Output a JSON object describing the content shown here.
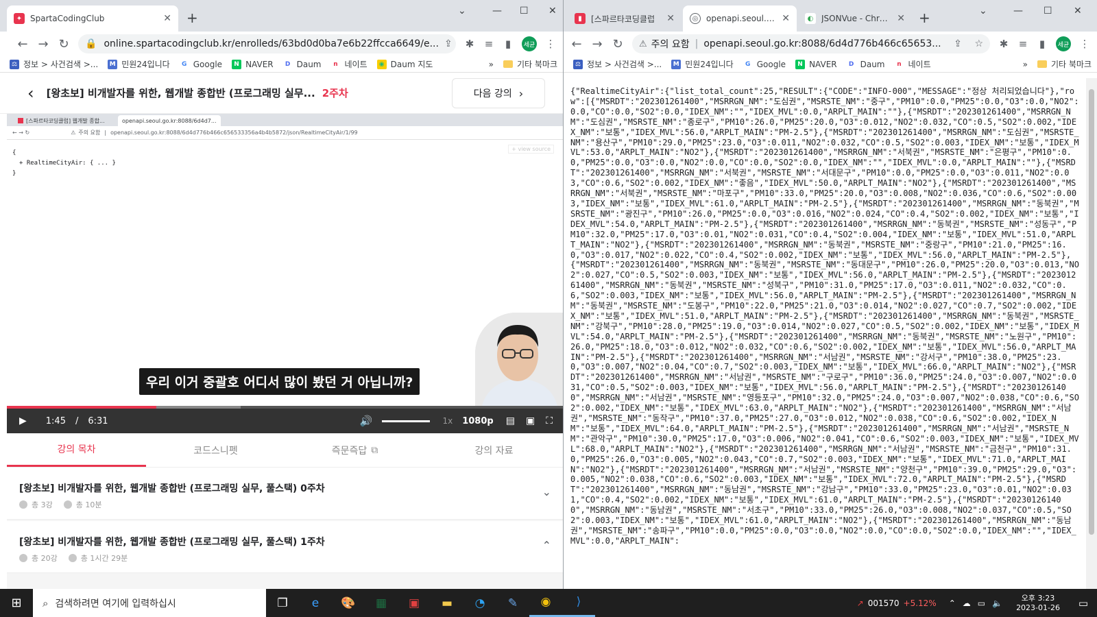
{
  "left": {
    "tabs": [
      {
        "title": "SpartaCodingClub",
        "active": true
      }
    ],
    "url": "online.spartacodingclub.kr/enrolleds/63bd0d0ba7e6b22ffcca6649/e...",
    "avatar": "세균",
    "bookmarks": [
      "정보 > 사건검색 >...",
      "민원24입니다",
      "Google",
      "NAVER",
      "Daum",
      "네이트",
      "Daum 지도"
    ],
    "bookmarks_more": "»",
    "other_bookmarks": "기타 북마크",
    "lecture_title": "[왕초보] 비개발자를 위한, 웹개발 종합반 (프로그래밍 실무...",
    "week": "2주차",
    "next_button": "다음 강의",
    "inner_browser": {
      "tab1": "[스파르타코딩클럽] 웹개발 종합...",
      "tab2": "openapi.seoul.go.kr:8088/6d4d7...",
      "url_warn": "주의 요함",
      "url": "openapi.seoul.go.kr:8088/6d4d776b466c656533356a4b4b5872/json/RealtimeCityAir/1/99",
      "view_source": "view source",
      "json_lines": [
        "{",
        "+ RealtimeCityAir: { ... }",
        "}"
      ]
    },
    "caption": "우리 이거 중괄호 어디서 많이 봤던 거 아닙니까?",
    "player": {
      "current": "1:45",
      "total": "6:31",
      "progress_fraction": 0.268,
      "buffer_fraction": 0.42,
      "speed": "1x",
      "quality": "1080p"
    },
    "lesson_tabs": [
      "강의 목차",
      "코드스니펫",
      "즉문즉답",
      "강의 자료"
    ],
    "curriculum": [
      {
        "title": "[왕초보] 비개발자를 위한, 웹개발 종합반 (프로그래밍 실무, 풀스택) 0주차",
        "lessons": "총 3강",
        "duration": "총 10분",
        "chevron": "⌄"
      },
      {
        "title": "[왕초보] 비개발자를 위한, 웹개발 종합반 (프로그래밍 실무, 풀스택) 1주차",
        "lessons": "총 20강",
        "duration": "총 1시간 29분",
        "chevron": "⌃"
      }
    ]
  },
  "right": {
    "tabs": [
      {
        "title": "[스파르타코딩클럽",
        "active": false
      },
      {
        "title": "openapi.seoul.go.k",
        "active": true
      },
      {
        "title": "JSONVue - Chrom",
        "active": false
      }
    ],
    "url_warn": "주의 요함",
    "url": "openapi.seoul.go.kr:8088/6d4d776b466c65653...",
    "avatar": "세균",
    "bookmarks": [
      "정보 > 사건검색 >...",
      "민원24입니다",
      "Google",
      "NAVER",
      "Daum",
      "네이트"
    ],
    "bookmarks_more": "»",
    "other_bookmarks": "기타 북마크",
    "json_text": "{\"RealtimeCityAir\":{\"list_total_count\":25,\"RESULT\":{\"CODE\":\"INFO-000\",\"MESSAGE\":\"정상 처리되었습니다\"},\"row\":[{\"MSRDT\":\"202301261400\",\"MSRRGN_NM\":\"도심권\",\"MSRSTE_NM\":\"중구\",\"PM10\":0.0,\"PM25\":0.0,\"O3\":0.0,\"NO2\":0.0,\"CO\":0.0,\"SO2\":0.0,\"IDEX_NM\":\"\",\"IDEX_MVL\":0.0,\"ARPLT_MAIN\":\"\"},{\"MSRDT\":\"202301261400\",\"MSRRGN_NM\":\"도심권\",\"MSRSTE_NM\":\"종로구\",\"PM10\":26.0,\"PM25\":20.0,\"O3\":0.012,\"NO2\":0.032,\"CO\":0.5,\"SO2\":0.002,\"IDEX_NM\":\"보통\",\"IDEX_MVL\":56.0,\"ARPLT_MAIN\":\"PM-2.5\"},{\"MSRDT\":\"202301261400\",\"MSRRGN_NM\":\"도심권\",\"MSRSTE_NM\":\"용산구\",\"PM10\":29.0,\"PM25\":23.0,\"O3\":0.011,\"NO2\":0.032,\"CO\":0.5,\"SO2\":0.003,\"IDEX_NM\":\"보통\",\"IDEX_MVL\":53.0,\"ARPLT_MAIN\":\"NO2\"},{\"MSRDT\":\"202301261400\",\"MSRRGN_NM\":\"서북권\",\"MSRSTE_NM\":\"은평구\",\"PM10\":0.0,\"PM25\":0.0,\"O3\":0.0,\"NO2\":0.0,\"CO\":0.0,\"SO2\":0.0,\"IDEX_NM\":\"\",\"IDEX_MVL\":0.0,\"ARPLT_MAIN\":\"\"},{\"MSRDT\":\"202301261400\",\"MSRRGN_NM\":\"서북권\",\"MSRSTE_NM\":\"서대문구\",\"PM10\":0.0,\"PM25\":0.0,\"O3\":0.011,\"NO2\":0.03,\"CO\":0.6,\"SO2\":0.002,\"IDEX_NM\":\"좋음\",\"IDEX_MVL\":50.0,\"ARPLT_MAIN\":\"NO2\"},{\"MSRDT\":\"202301261400\",\"MSRRGN_NM\":\"서북권\",\"MSRSTE_NM\":\"마포구\",\"PM10\":33.0,\"PM25\":20.0,\"O3\":0.008,\"NO2\":0.036,\"CO\":0.6,\"SO2\":0.003,\"IDEX_NM\":\"보통\",\"IDEX_MVL\":61.0,\"ARPLT_MAIN\":\"PM-2.5\"},{\"MSRDT\":\"202301261400\",\"MSRRGN_NM\":\"동북권\",\"MSRSTE_NM\":\"광진구\",\"PM10\":26.0,\"PM25\":0.0,\"O3\":0.016,\"NO2\":0.024,\"CO\":0.4,\"SO2\":0.002,\"IDEX_NM\":\"보통\",\"IDEX_MVL\":54.0,\"ARPLT_MAIN\":\"PM-2.5\"},{\"MSRDT\":\"202301261400\",\"MSRRGN_NM\":\"동북권\",\"MSRSTE_NM\":\"성동구\",\"PM10\":32.0,\"PM25\":17.0,\"O3\":0.01,\"NO2\":0.031,\"CO\":0.4,\"SO2\":0.004,\"IDEX_NM\":\"보통\",\"IDEX_MVL\":51.0,\"ARPLT_MAIN\":\"NO2\"},{\"MSRDT\":\"202301261400\",\"MSRRGN_NM\":\"동북권\",\"MSRSTE_NM\":\"중랑구\",\"PM10\":21.0,\"PM25\":16.0,\"O3\":0.017,\"NO2\":0.022,\"CO\":0.4,\"SO2\":0.002,\"IDEX_NM\":\"보통\",\"IDEX_MVL\":56.0,\"ARPLT_MAIN\":\"PM-2.5\"},{\"MSRDT\":\"202301261400\",\"MSRRGN_NM\":\"동북권\",\"MSRSTE_NM\":\"동대문구\",\"PM10\":26.0,\"PM25\":20.0,\"O3\":0.013,\"NO2\":0.027,\"CO\":0.5,\"SO2\":0.003,\"IDEX_NM\":\"보통\",\"IDEX_MVL\":56.0,\"ARPLT_MAIN\":\"PM-2.5\"},{\"MSRDT\":\"202301261400\",\"MSRRGN_NM\":\"동북권\",\"MSRSTE_NM\":\"성북구\",\"PM10\":31.0,\"PM25\":17.0,\"O3\":0.011,\"NO2\":0.032,\"CO\":0.6,\"SO2\":0.003,\"IDEX_NM\":\"보통\",\"IDEX_MVL\":56.0,\"ARPLT_MAIN\":\"PM-2.5\"},{\"MSRDT\":\"202301261400\",\"MSRRGN_NM\":\"동북권\",\"MSRSTE_NM\":\"도봉구\",\"PM10\":22.0,\"PM25\":21.0,\"O3\":0.014,\"NO2\":0.027,\"CO\":0.7,\"SO2\":0.002,\"IDEX_NM\":\"보통\",\"IDEX_MVL\":51.0,\"ARPLT_MAIN\":\"PM-2.5\"},{\"MSRDT\":\"202301261400\",\"MSRRGN_NM\":\"동북권\",\"MSRSTE_NM\":\"강북구\",\"PM10\":28.0,\"PM25\":19.0,\"O3\":0.014,\"NO2\":0.027,\"CO\":0.5,\"SO2\":0.002,\"IDEX_NM\":\"보통\",\"IDEX_MVL\":54.0,\"ARPLT_MAIN\":\"PM-2.5\"},{\"MSRDT\":\"202301261400\",\"MSRRGN_NM\":\"동북권\",\"MSRSTE_NM\":\"노원구\",\"PM10\":26.0,\"PM25\":18.0,\"O3\":0.012,\"NO2\":0.032,\"CO\":0.6,\"SO2\":0.002,\"IDEX_NM\":\"보통\",\"IDEX_MVL\":56.0,\"ARPLT_MAIN\":\"PM-2.5\"},{\"MSRDT\":\"202301261400\",\"MSRRGN_NM\":\"서남권\",\"MSRSTE_NM\":\"강서구\",\"PM10\":38.0,\"PM25\":23.0,\"O3\":0.007,\"NO2\":0.04,\"CO\":0.7,\"SO2\":0.003,\"IDEX_NM\":\"보통\",\"IDEX_MVL\":66.0,\"ARPLT_MAIN\":\"NO2\"},{\"MSRDT\":\"202301261400\",\"MSRRGN_NM\":\"서남권\",\"MSRSTE_NM\":\"구로구\",\"PM10\":36.0,\"PM25\":24.0,\"O3\":0.007,\"NO2\":0.031,\"CO\":0.5,\"SO2\":0.003,\"IDEX_NM\":\"보통\",\"IDEX_MVL\":56.0,\"ARPLT_MAIN\":\"PM-2.5\"},{\"MSRDT\":\"202301261400\",\"MSRRGN_NM\":\"서남권\",\"MSRSTE_NM\":\"영등포구\",\"PM10\":32.0,\"PM25\":24.0,\"O3\":0.007,\"NO2\":0.038,\"CO\":0.6,\"SO2\":0.002,\"IDEX_NM\":\"보통\",\"IDEX_MVL\":63.0,\"ARPLT_MAIN\":\"NO2\"},{\"MSRDT\":\"202301261400\",\"MSRRGN_NM\":\"서남권\",\"MSRSTE_NM\":\"동작구\",\"PM10\":37.0,\"PM25\":27.0,\"O3\":0.012,\"NO2\":0.038,\"CO\":0.6,\"SO2\":0.002,\"IDEX_NM\":\"보통\",\"IDEX_MVL\":64.0,\"ARPLT_MAIN\":\"PM-2.5\"},{\"MSRDT\":\"202301261400\",\"MSRRGN_NM\":\"서남권\",\"MSRSTE_NM\":\"관악구\",\"PM10\":30.0,\"PM25\":17.0,\"O3\":0.006,\"NO2\":0.041,\"CO\":0.6,\"SO2\":0.003,\"IDEX_NM\":\"보통\",\"IDEX_MVL\":68.0,\"ARPLT_MAIN\":\"NO2\"},{\"MSRDT\":\"202301261400\",\"MSRRGN_NM\":\"서남권\",\"MSRSTE_NM\":\"금천구\",\"PM10\":31.0,\"PM25\":26.0,\"O3\":0.005,\"NO2\":0.043,\"CO\":0.7,\"SO2\":0.003,\"IDEX_NM\":\"보통\",\"IDEX_MVL\":71.0,\"ARPLT_MAIN\":\"NO2\"},{\"MSRDT\":\"202301261400\",\"MSRRGN_NM\":\"서남권\",\"MSRSTE_NM\":\"양천구\",\"PM10\":39.0,\"PM25\":29.0,\"O3\":0.005,\"NO2\":0.038,\"CO\":0.6,\"SO2\":0.003,\"IDEX_NM\":\"보통\",\"IDEX_MVL\":72.0,\"ARPLT_MAIN\":\"PM-2.5\"},{\"MSRDT\":\"202301261400\",\"MSRRGN_NM\":\"동남권\",\"MSRSTE_NM\":\"강남구\",\"PM10\":33.0,\"PM25\":23.0,\"O3\":0.01,\"NO2\":0.031,\"CO\":0.4,\"SO2\":0.002,\"IDEX_NM\":\"보통\",\"IDEX_MVL\":61.0,\"ARPLT_MAIN\":\"PM-2.5\"},{\"MSRDT\":\"202301261400\",\"MSRRGN_NM\":\"동남권\",\"MSRSTE_NM\":\"서초구\",\"PM10\":33.0,\"PM25\":26.0,\"O3\":0.008,\"NO2\":0.037,\"CO\":0.5,\"SO2\":0.003,\"IDEX_NM\":\"보통\",\"IDEX_MVL\":61.0,\"ARPLT_MAIN\":\"NO2\"},{\"MSRDT\":\"202301261400\",\"MSRRGN_NM\":\"동남권\",\"MSRSTE_NM\":\"송파구\",\"PM10\":0.0,\"PM25\":0.0,\"O3\":0.0,\"NO2\":0.0,\"CO\":0.0,\"SO2\":0.0,\"IDEX_NM\":\"\",\"IDEX_MVL\":0.0,\"ARPLT_MAIN\":"
  },
  "taskbar": {
    "search_placeholder": "검색하려면 여기에 입력하십시",
    "stock_code": "001570",
    "stock_change": "+5.12%",
    "time": "오후 3:23",
    "date": "2023-01-26"
  }
}
